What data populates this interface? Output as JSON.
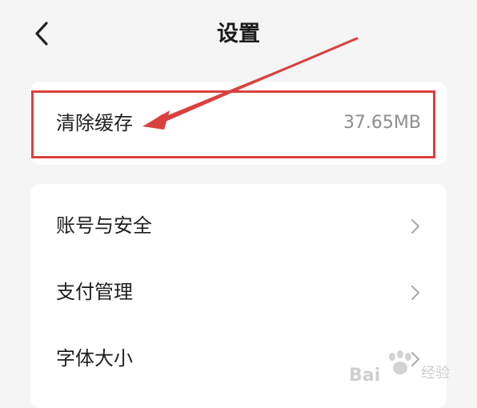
{
  "header": {
    "title": "设置",
    "back_icon": "chevron-left-icon"
  },
  "cache": {
    "label": "清除缓存",
    "value": "37.65MB"
  },
  "settings": {
    "items": [
      {
        "label": "账号与安全",
        "icon": "chevron-right-icon"
      },
      {
        "label": "支付管理",
        "icon": "chevron-right-icon"
      },
      {
        "label": "字体大小",
        "icon": "chevron-right-icon"
      }
    ]
  },
  "annotation": {
    "color": "#d9413e"
  },
  "watermark": {
    "text": "Bai",
    "sub": "经验"
  }
}
